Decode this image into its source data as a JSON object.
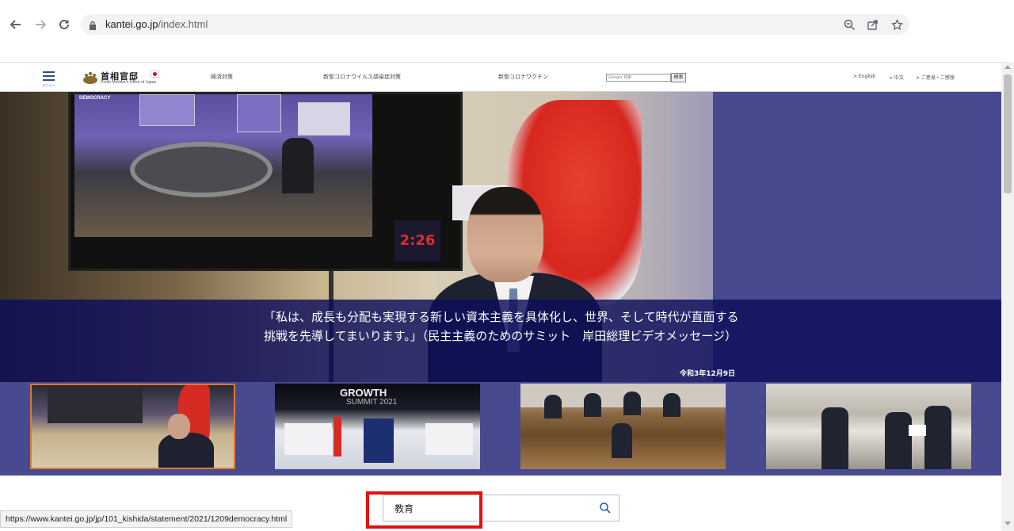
{
  "browser": {
    "url_domain": "kantei.go.jp",
    "url_path": "/index.html",
    "status_url": "https://www.kantei.go.jp/jp/101_kishida/statement/2021/1209democracy.html",
    "icons": [
      "back-arrow-icon",
      "forward-arrow-icon",
      "reload-icon",
      "lock-icon",
      "zoom-icon",
      "share-icon",
      "star-icon"
    ]
  },
  "header": {
    "menu_label": "メニュー",
    "logo_title": "首相官邸",
    "logo_subtitle": "Prime Minister's Office of Japan",
    "nav": [
      "経済対策",
      "新型コロナウイルス感染症対策",
      "新型コロナワクチン"
    ],
    "google_search_placeholder": "Google 検索",
    "google_search_button": "検索",
    "util_links": [
      "> English",
      "> 中文",
      "> ご意見・ご感想"
    ]
  },
  "hero": {
    "caption": "「私は、成長も分配も実現する新しい資本主義を具体化し、世界、そして時代が直面する挑戦を先導してまいります。」（民主主義のためのサミット　岸田総理ビデオメッセージ）",
    "date": "令和3年12月9日",
    "timer": "2:26",
    "monitor_logo": "DEMOCRACY",
    "colors": {
      "hero_bg": "#474a8f",
      "caption_bg": "#0c0e5a"
    }
  },
  "thumbnails": {
    "growth_title": "GROWTH",
    "growth_sub": "SUMMIT 2021"
  },
  "search": {
    "value": "教育",
    "icon": "magnifier-icon"
  }
}
